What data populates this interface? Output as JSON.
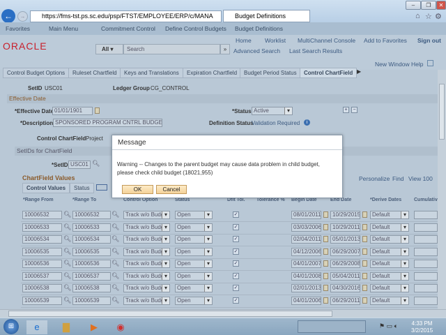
{
  "browser": {
    "url": "https://fms-tst.ps.sc.edu/psp/FTST/EMPLOYEE/ERP/c/MANA",
    "tab_title": "Budget Definitions"
  },
  "nav": {
    "favorites": "Favorites",
    "main_menu": "Main Menu",
    "crumbs": [
      "Commitment Control",
      "Define Control Budgets",
      "Budget Definitions"
    ]
  },
  "header": {
    "logo": "ORACLE",
    "links": [
      "Home",
      "Worklist",
      "MultiChannel Console",
      "Add to Favorites",
      "Sign out"
    ],
    "search_scope": "All",
    "search_placeholder": "Search",
    "advanced_search": "Advanced Search",
    "last_search": "Last Search Results"
  },
  "page_links": {
    "new_window": "New Window",
    "help": "Help"
  },
  "tabs": [
    "Control Budget Options",
    "Ruleset Chartfield",
    "Keys and Translations",
    "Expiration Chartfield",
    "Budget Period Status",
    "Control ChartField"
  ],
  "form": {
    "setid_label": "SetID",
    "setid": "USC01",
    "ledger_label": "Ledger Group",
    "ledger": "CG_CONTROL",
    "section": "Effective Date",
    "eff_label": "*Effective Date",
    "eff_date": "01/01/1901",
    "status_label": "*Status",
    "status": "Active",
    "desc_label": "*Description",
    "desc": "SPONSORED PROGRAM CNTRL BUDGET",
    "defstat_label": "Definition Status",
    "defstat": "Validation Required",
    "ccf_label": "Control ChartField",
    "ccf": "Project",
    "setids_section": "SetIDs for ChartField",
    "setid2_label": "*SetID",
    "setid2": "USC01"
  },
  "grid": {
    "title": "ChartField Values",
    "personalize": "Personalize",
    "find": "Find",
    "view": "View 100",
    "subtabs": [
      "Control Values",
      "Status"
    ],
    "headers": [
      "*Range From",
      "*Range To",
      "Control Option",
      "Status",
      "Dflt Tol.",
      "Tolerance %",
      "Begin Date",
      "End Date",
      "*Derive Dates",
      "Cumulative"
    ],
    "rows": [
      {
        "from": "10006532",
        "to": "10006532",
        "option": "Track w/o Budg",
        "status": "Open",
        "dflt": true,
        "begin": "08/01/2011",
        "end": "10/29/2015",
        "derive": "Default"
      },
      {
        "from": "10006533",
        "to": "10006533",
        "option": "Track w/o Budg",
        "status": "Open",
        "dflt": true,
        "begin": "03/03/2006",
        "end": "10/29/2011",
        "derive": "Default"
      },
      {
        "from": "10006534",
        "to": "10006534",
        "option": "Track w/o Budg",
        "status": "Open",
        "dflt": true,
        "begin": "02/04/2011",
        "end": "05/01/2013",
        "derive": "Default"
      },
      {
        "from": "10006535",
        "to": "10006535",
        "option": "Track w/o Budg",
        "status": "Open",
        "dflt": true,
        "begin": "04/12/2006",
        "end": "06/29/2007",
        "derive": "Default"
      },
      {
        "from": "10006536",
        "to": "10006536",
        "option": "Track w/o Budg",
        "status": "Open",
        "dflt": true,
        "begin": "04/01/2007",
        "end": "06/29/2008",
        "derive": "Default"
      },
      {
        "from": "10006537",
        "to": "10006537",
        "option": "Track w/o Budg",
        "status": "Open",
        "dflt": true,
        "begin": "04/01/2008",
        "end": "05/04/2011",
        "derive": "Default"
      },
      {
        "from": "10006538",
        "to": "10006538",
        "option": "Track w/o Budg",
        "status": "Open",
        "dflt": true,
        "begin": "02/01/2013",
        "end": "04/30/2016",
        "derive": "Default"
      },
      {
        "from": "10006539",
        "to": "10006539",
        "option": "Track w/o Budg",
        "status": "Open",
        "dflt": true,
        "begin": "04/01/2006",
        "end": "06/29/2011",
        "derive": "Default"
      }
    ]
  },
  "dialog": {
    "title": "Message",
    "text": "Warning -- Changes to the parent budget may cause data problem in child budget, please check child budget (18021,955)",
    "ok": "OK",
    "cancel": "Cancel"
  },
  "taskbar": {
    "time": "4:33 PM",
    "date": "3/2/2015"
  },
  "colors": {
    "oracle_red": "#c8202c",
    "link": "#3c5a80",
    "section_text": "#8a5a2a"
  }
}
